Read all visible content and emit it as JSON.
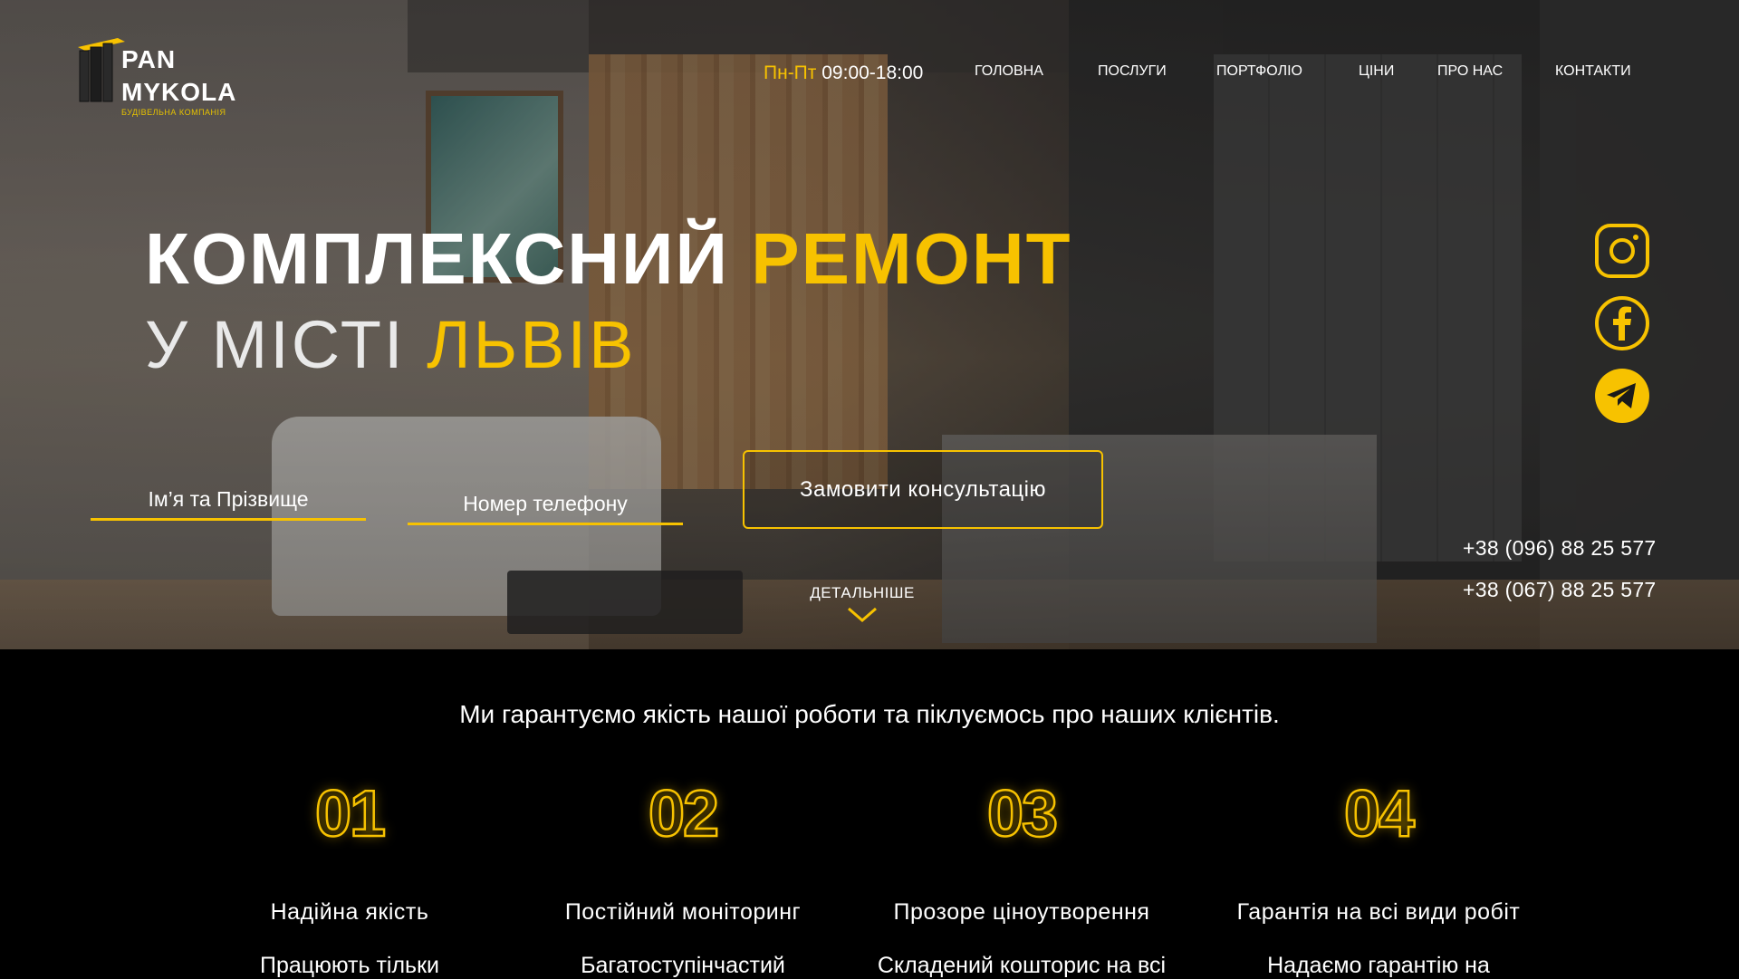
{
  "brand": {
    "name_line1": "PAN",
    "name_line2": "MYKOLA",
    "subtitle": "БУДІВЕЛЬНА КОМПАНІЯ",
    "accent_color": "#f7c200"
  },
  "header": {
    "hours_days": "Пн-Пт",
    "hours_time": "09:00-18:00",
    "nav": [
      "ГОЛОВНА",
      "ПОСЛУГИ",
      "ПОРТФОЛІО",
      "ЦІНИ",
      "ПРО НАС",
      "КОНТАКТИ"
    ]
  },
  "hero": {
    "headline_white": "КОМПЛЕКСНИЙ",
    "headline_accent": "РЕМОНТ",
    "subheadline_white": "У МІСТІ",
    "subheadline_accent": "ЛЬВІВ",
    "form": {
      "name_placeholder": "Ім’я та Прізвище",
      "phone_placeholder": "Номер телефону",
      "submit_label": "Замовити консультацію"
    },
    "more_label": "ДЕТАЛЬНІШЕ"
  },
  "social": [
    {
      "icon": "instagram-icon"
    },
    {
      "icon": "facebook-icon"
    },
    {
      "icon": "telegram-icon"
    }
  ],
  "phones": [
    "+38 (096) 88 25 577",
    "+38 (067) 88 25 577"
  ],
  "guarantees": {
    "tagline": "Ми гарантуємо якість нашої роботи та піклуємось про наших клієнтів.",
    "items": [
      {
        "number": "01",
        "title": "Надійна якість",
        "desc": "Працюють тільки"
      },
      {
        "number": "02",
        "title": "Постійний моніторинг",
        "desc": "Багатоступінчастий"
      },
      {
        "number": "03",
        "title": "Прозоре ціноутворення",
        "desc": "Складений кошторис на всі"
      },
      {
        "number": "04",
        "title": "Гарантія на всі види робіт",
        "desc": "Надаємо гарантію на"
      }
    ]
  }
}
